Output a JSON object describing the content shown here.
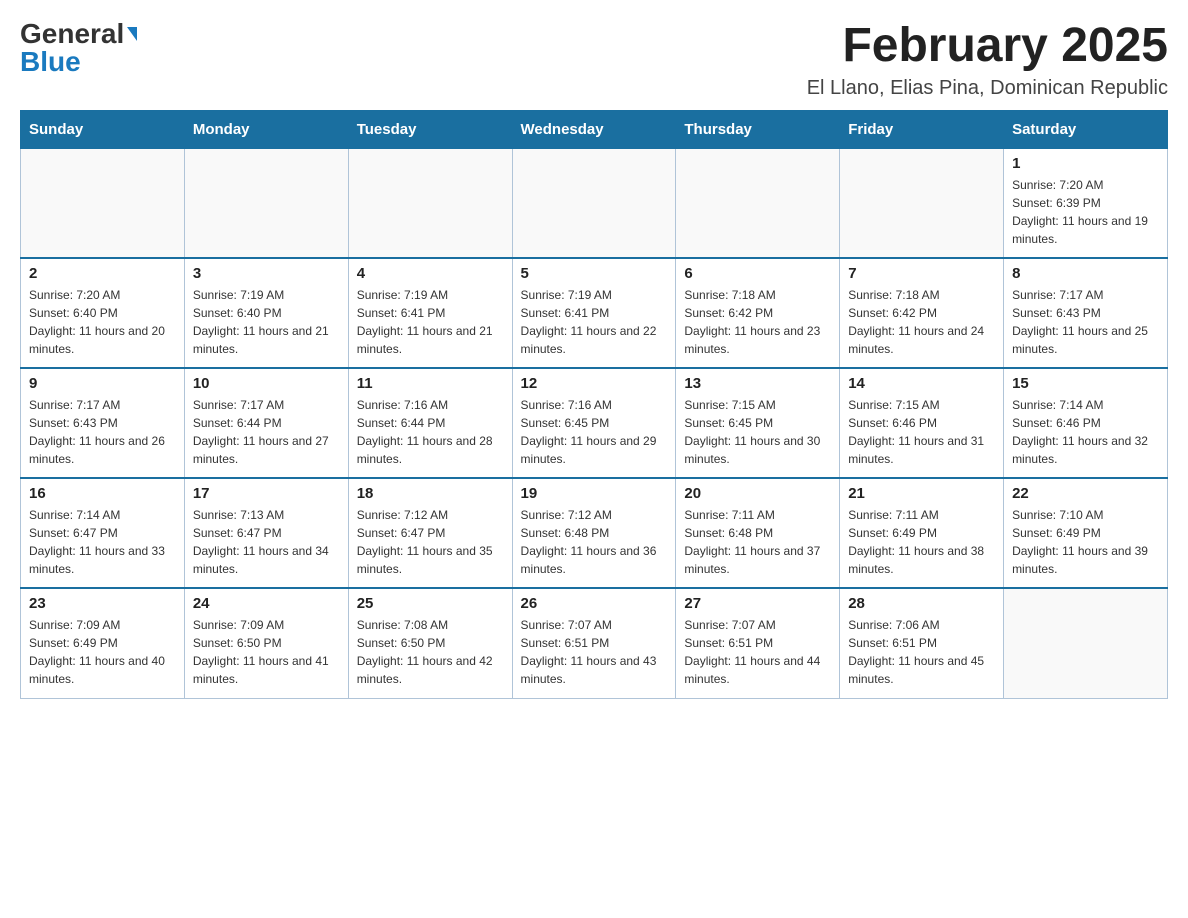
{
  "header": {
    "logo_general": "General",
    "logo_blue": "Blue",
    "month_title": "February 2025",
    "location": "El Llano, Elias Pina, Dominican Republic"
  },
  "days_of_week": [
    "Sunday",
    "Monday",
    "Tuesday",
    "Wednesday",
    "Thursday",
    "Friday",
    "Saturday"
  ],
  "weeks": [
    [
      {
        "day": "",
        "info": ""
      },
      {
        "day": "",
        "info": ""
      },
      {
        "day": "",
        "info": ""
      },
      {
        "day": "",
        "info": ""
      },
      {
        "day": "",
        "info": ""
      },
      {
        "day": "",
        "info": ""
      },
      {
        "day": "1",
        "info": "Sunrise: 7:20 AM\nSunset: 6:39 PM\nDaylight: 11 hours and 19 minutes."
      }
    ],
    [
      {
        "day": "2",
        "info": "Sunrise: 7:20 AM\nSunset: 6:40 PM\nDaylight: 11 hours and 20 minutes."
      },
      {
        "day": "3",
        "info": "Sunrise: 7:19 AM\nSunset: 6:40 PM\nDaylight: 11 hours and 21 minutes."
      },
      {
        "day": "4",
        "info": "Sunrise: 7:19 AM\nSunset: 6:41 PM\nDaylight: 11 hours and 21 minutes."
      },
      {
        "day": "5",
        "info": "Sunrise: 7:19 AM\nSunset: 6:41 PM\nDaylight: 11 hours and 22 minutes."
      },
      {
        "day": "6",
        "info": "Sunrise: 7:18 AM\nSunset: 6:42 PM\nDaylight: 11 hours and 23 minutes."
      },
      {
        "day": "7",
        "info": "Sunrise: 7:18 AM\nSunset: 6:42 PM\nDaylight: 11 hours and 24 minutes."
      },
      {
        "day": "8",
        "info": "Sunrise: 7:17 AM\nSunset: 6:43 PM\nDaylight: 11 hours and 25 minutes."
      }
    ],
    [
      {
        "day": "9",
        "info": "Sunrise: 7:17 AM\nSunset: 6:43 PM\nDaylight: 11 hours and 26 minutes."
      },
      {
        "day": "10",
        "info": "Sunrise: 7:17 AM\nSunset: 6:44 PM\nDaylight: 11 hours and 27 minutes."
      },
      {
        "day": "11",
        "info": "Sunrise: 7:16 AM\nSunset: 6:44 PM\nDaylight: 11 hours and 28 minutes."
      },
      {
        "day": "12",
        "info": "Sunrise: 7:16 AM\nSunset: 6:45 PM\nDaylight: 11 hours and 29 minutes."
      },
      {
        "day": "13",
        "info": "Sunrise: 7:15 AM\nSunset: 6:45 PM\nDaylight: 11 hours and 30 minutes."
      },
      {
        "day": "14",
        "info": "Sunrise: 7:15 AM\nSunset: 6:46 PM\nDaylight: 11 hours and 31 minutes."
      },
      {
        "day": "15",
        "info": "Sunrise: 7:14 AM\nSunset: 6:46 PM\nDaylight: 11 hours and 32 minutes."
      }
    ],
    [
      {
        "day": "16",
        "info": "Sunrise: 7:14 AM\nSunset: 6:47 PM\nDaylight: 11 hours and 33 minutes."
      },
      {
        "day": "17",
        "info": "Sunrise: 7:13 AM\nSunset: 6:47 PM\nDaylight: 11 hours and 34 minutes."
      },
      {
        "day": "18",
        "info": "Sunrise: 7:12 AM\nSunset: 6:47 PM\nDaylight: 11 hours and 35 minutes."
      },
      {
        "day": "19",
        "info": "Sunrise: 7:12 AM\nSunset: 6:48 PM\nDaylight: 11 hours and 36 minutes."
      },
      {
        "day": "20",
        "info": "Sunrise: 7:11 AM\nSunset: 6:48 PM\nDaylight: 11 hours and 37 minutes."
      },
      {
        "day": "21",
        "info": "Sunrise: 7:11 AM\nSunset: 6:49 PM\nDaylight: 11 hours and 38 minutes."
      },
      {
        "day": "22",
        "info": "Sunrise: 7:10 AM\nSunset: 6:49 PM\nDaylight: 11 hours and 39 minutes."
      }
    ],
    [
      {
        "day": "23",
        "info": "Sunrise: 7:09 AM\nSunset: 6:49 PM\nDaylight: 11 hours and 40 minutes."
      },
      {
        "day": "24",
        "info": "Sunrise: 7:09 AM\nSunset: 6:50 PM\nDaylight: 11 hours and 41 minutes."
      },
      {
        "day": "25",
        "info": "Sunrise: 7:08 AM\nSunset: 6:50 PM\nDaylight: 11 hours and 42 minutes."
      },
      {
        "day": "26",
        "info": "Sunrise: 7:07 AM\nSunset: 6:51 PM\nDaylight: 11 hours and 43 minutes."
      },
      {
        "day": "27",
        "info": "Sunrise: 7:07 AM\nSunset: 6:51 PM\nDaylight: 11 hours and 44 minutes."
      },
      {
        "day": "28",
        "info": "Sunrise: 7:06 AM\nSunset: 6:51 PM\nDaylight: 11 hours and 45 minutes."
      },
      {
        "day": "",
        "info": ""
      }
    ]
  ]
}
